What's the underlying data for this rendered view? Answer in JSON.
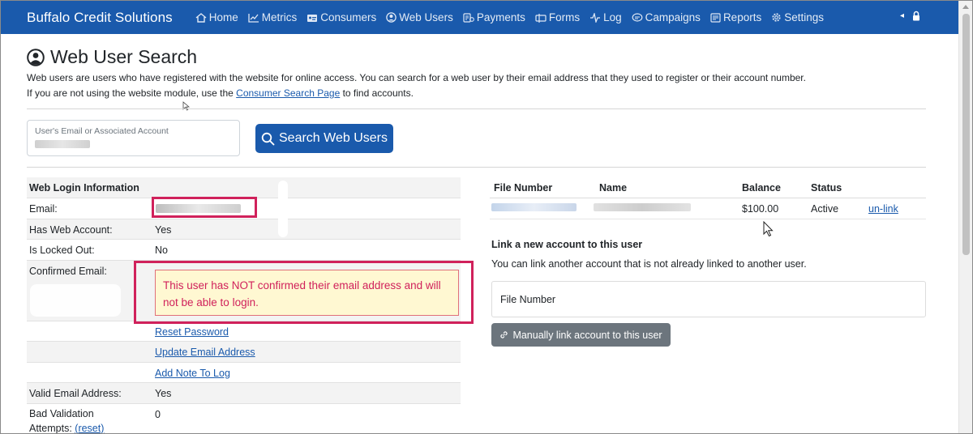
{
  "navbar": {
    "brand": "Buffalo Credit Solutions",
    "items": [
      {
        "label": "Home",
        "icon": "home-icon"
      },
      {
        "label": "Metrics",
        "icon": "chart-line-icon"
      },
      {
        "label": "Consumers",
        "icon": "id-card-icon"
      },
      {
        "label": "Web Users",
        "icon": "user-circle-icon"
      },
      {
        "label": "Payments",
        "icon": "payments-icon"
      },
      {
        "label": "Forms",
        "icon": "forms-icon"
      },
      {
        "label": "Log",
        "icon": "activity-icon"
      },
      {
        "label": "Campaigns",
        "icon": "chat-icon"
      },
      {
        "label": "Reports",
        "icon": "report-icon"
      },
      {
        "label": "Settings",
        "icon": "gear-icon"
      }
    ],
    "right": {
      "caret": "◂",
      "icon": "lock-icon"
    }
  },
  "page": {
    "title": "Web User Search",
    "desc1": "Web users are users who have registered with the website for online access. You can search for a web user by their email address that they used to register or their account number.",
    "desc2_pre": "If you are not using the website module, use the ",
    "desc2_link": "Consumer Search Page",
    "desc2_post": " to find accounts."
  },
  "search": {
    "label": "User's Email or Associated Account",
    "button": "Search Web Users"
  },
  "login_info": {
    "header": "Web Login Information",
    "email_label": "Email:",
    "has_web_account_label": "Has Web Account:",
    "has_web_account": "Yes",
    "locked_out_label": "Is Locked Out:",
    "locked_out": "No",
    "confirmed_label": "Confirmed Email:",
    "alert": "This user has NOT confirmed their email address and will not be able to login.",
    "reset_password": "Reset Password",
    "update_email": "Update Email Address",
    "add_note": "Add Note To Log",
    "valid_label": "Valid Email Address:",
    "valid": "Yes",
    "bad_validation_label": "Bad Validation Attempts:",
    "reset_link": "(reset)",
    "bad_validation": "0"
  },
  "accounts": {
    "headers": {
      "file_number": "File Number",
      "name": "Name",
      "balance": "Balance",
      "status": "Status"
    },
    "rows": [
      {
        "balance": "$100.00",
        "status": "Active",
        "action": "un-link"
      }
    ],
    "link_title": "Link a new account to this user",
    "link_desc": "You can link another account that is not already linked to another user.",
    "file_number_placeholder": "File Number",
    "link_button": "Manually link account to this user"
  },
  "colors": {
    "navbar": "#1a5aac",
    "alert_text": "#d0215b",
    "alert_bg": "#fff8d2",
    "highlight": "#d0215b"
  }
}
